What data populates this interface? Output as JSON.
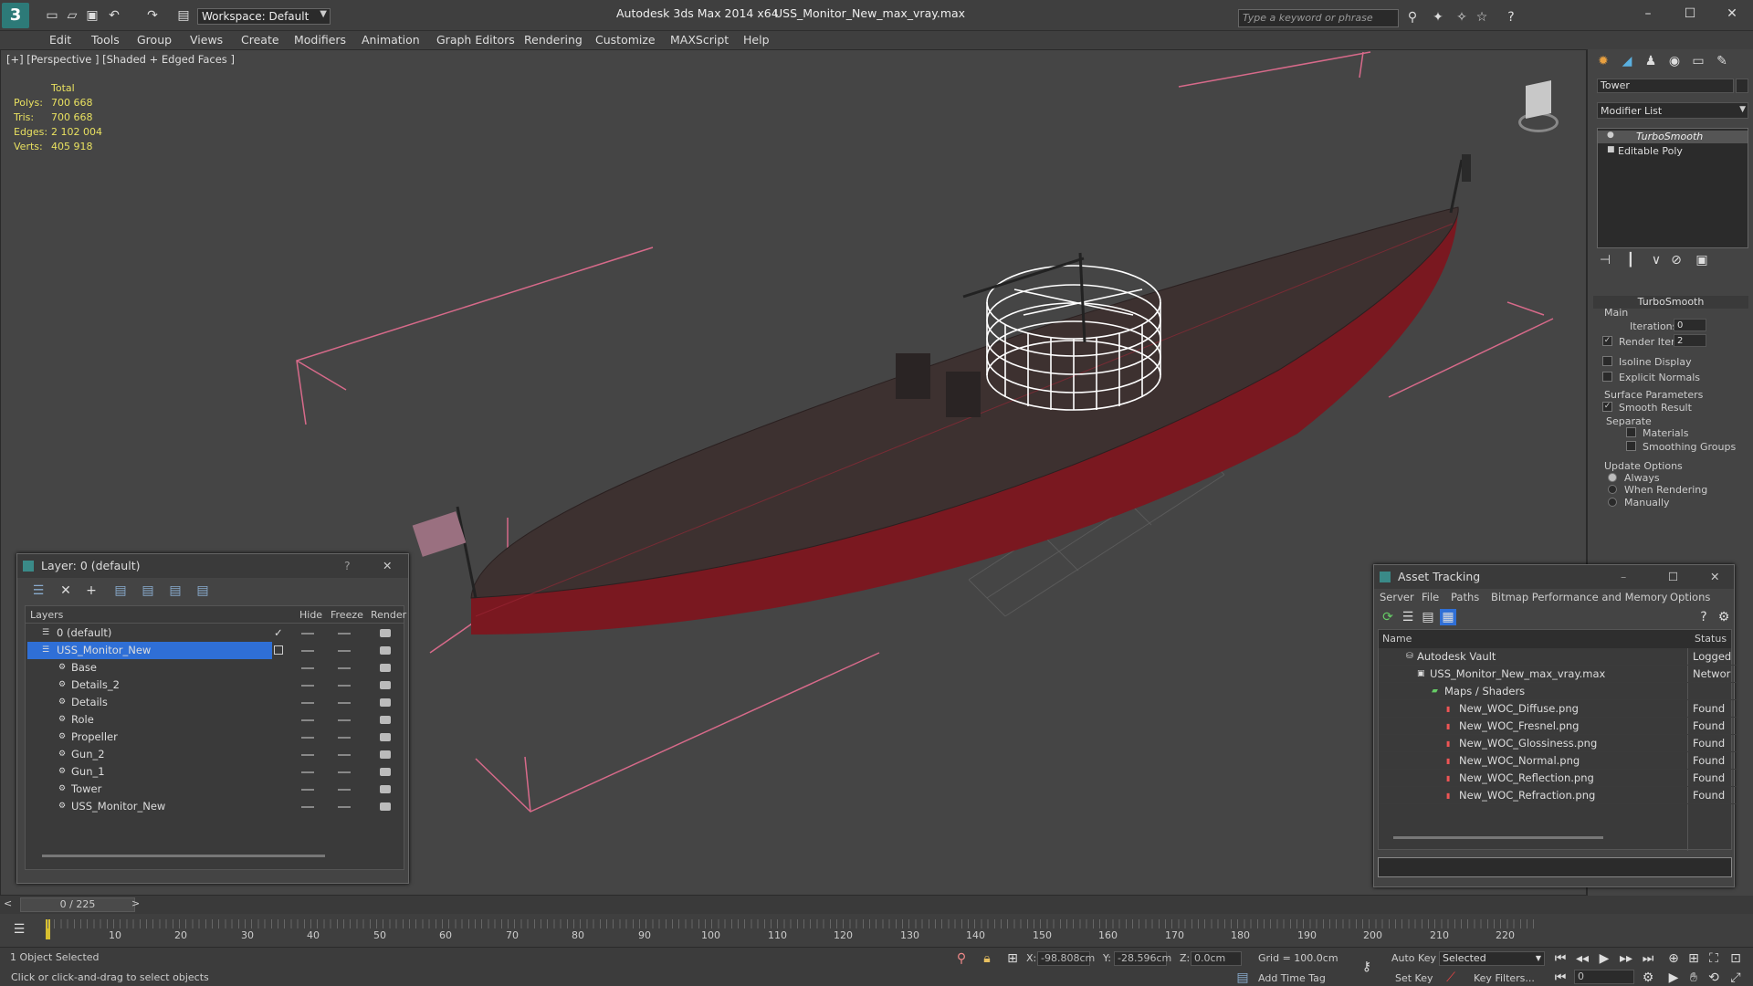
{
  "app": {
    "title": "Autodesk 3ds Max  2014 x64",
    "file": "USS_Monitor_New_max_vray.max",
    "workspace": "Workspace: Default",
    "search_placeholder": "Type a keyword or phrase"
  },
  "menu": [
    "Edit",
    "Tools",
    "Group",
    "Views",
    "Create",
    "Modifiers",
    "Animation",
    "Graph Editors",
    "Rendering",
    "Customize",
    "MAXScript",
    "Help"
  ],
  "viewport": {
    "label": "[+] [Perspective ] [Shaded + Edged Faces ]",
    "stats": {
      "header": "Total",
      "rows": [
        {
          "label": "Polys:",
          "value": "700 668"
        },
        {
          "label": "Tris:",
          "value": "700 668"
        },
        {
          "label": "Edges:",
          "value": "2 102 004"
        },
        {
          "label": "Verts:",
          "value": "405 918"
        }
      ]
    }
  },
  "command_panel": {
    "object_name": "Tower",
    "modifier_list": "Modifier List",
    "stack": [
      "TurboSmooth",
      "Editable Poly"
    ],
    "rollout_title": "TurboSmooth",
    "main_label": "Main",
    "iterations_label": "Iterations:",
    "iterations_value": "0",
    "render_iters_label": "Render Iters:",
    "render_iters_value": "2",
    "isoline_label": "Isoline Display",
    "explicit_normals_label": "Explicit Normals",
    "surface_params_label": "Surface Parameters",
    "smooth_result_label": "Smooth Result",
    "separate_label": "Separate",
    "materials_label": "Materials",
    "smoothing_groups_label": "Smoothing Groups",
    "update_options_label": "Update Options",
    "always_label": "Always",
    "when_rendering_label": "When Rendering",
    "manually_label": "Manually"
  },
  "layer_panel": {
    "title": "Layer: 0 (default)",
    "help": "?",
    "columns": {
      "layers": "Layers",
      "hide": "Hide",
      "freeze": "Freeze",
      "render": "Render"
    },
    "rows": [
      "0 (default)",
      "USS_Monitor_New",
      "Base",
      "Details_2",
      "Details",
      "Role",
      "Propeller",
      "Gun_2",
      "Gun_1",
      "Tower",
      "USS_Monitor_New"
    ]
  },
  "asset_tracking": {
    "title": "Asset Tracking",
    "menu": [
      "Server",
      "File",
      "Paths",
      "Bitmap Performance and Memory",
      "Options"
    ],
    "columns": {
      "name": "Name",
      "status": "Status"
    },
    "rows": [
      {
        "name": "Autodesk Vault",
        "status": "Logged"
      },
      {
        "name": "USS_Monitor_New_max_vray.max",
        "status": "Network"
      },
      {
        "name": "Maps / Shaders",
        "status": ""
      },
      {
        "name": "New_WOC_Diffuse.png",
        "status": "Found"
      },
      {
        "name": "New_WOC_Fresnel.png",
        "status": "Found"
      },
      {
        "name": "New_WOC_Glossiness.png",
        "status": "Found"
      },
      {
        "name": "New_WOC_Normal.png",
        "status": "Found"
      },
      {
        "name": "New_WOC_Reflection.png",
        "status": "Found"
      },
      {
        "name": "New_WOC_Refraction.png",
        "status": "Found"
      }
    ]
  },
  "timeline": {
    "frame_display": "0 / 225",
    "ticks": [
      "10",
      "20",
      "30",
      "40",
      "50",
      "60",
      "70",
      "80",
      "90",
      "100",
      "110",
      "120",
      "130",
      "140",
      "150",
      "160",
      "170",
      "180",
      "190",
      "200",
      "210",
      "220"
    ]
  },
  "status": {
    "selection": "1 Object Selected",
    "prompt": "Click or click-and-drag to select objects",
    "x_label": "X:",
    "x_value": "-98.808cm",
    "y_label": "Y:",
    "y_value": "-28.596cm",
    "z_label": "Z:",
    "z_value": "0.0cm",
    "grid": "Grid = 100.0cm",
    "add_time_tag": "Add Time Tag",
    "auto_key": "Auto Key",
    "set_key": "Set Key",
    "selected": "Selected",
    "key_filters": "Key Filters...",
    "frame_value": "0"
  },
  "colors": {
    "accent": "#2f6fd6",
    "hull_red": "#8a1a22",
    "selection_pink": "#d76a8a"
  }
}
